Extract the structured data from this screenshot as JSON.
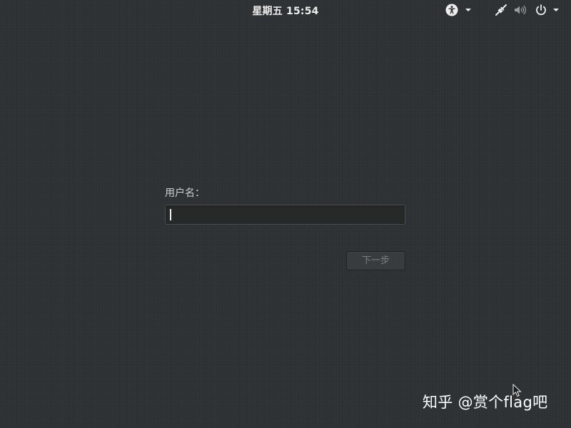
{
  "topbar": {
    "clock_day": "星期五",
    "clock_time": "15:54"
  },
  "icons": {
    "accessibility": "accessibility-icon",
    "network": "network-icon",
    "volume": "volume-icon",
    "power": "power-icon",
    "dropdown": "dropdown-arrow-icon",
    "cursor": "mouse-pointer-icon"
  },
  "login": {
    "username_label": "用户名：",
    "username_value": "",
    "next_label": "下一步"
  },
  "watermark": {
    "text": "知乎 @赏个flag吧"
  },
  "colors": {
    "background": "#2e3134",
    "text": "#eeeeec",
    "input_background": "#272828",
    "button_background": "#393c3f",
    "button_text_disabled": "#7d8081"
  }
}
